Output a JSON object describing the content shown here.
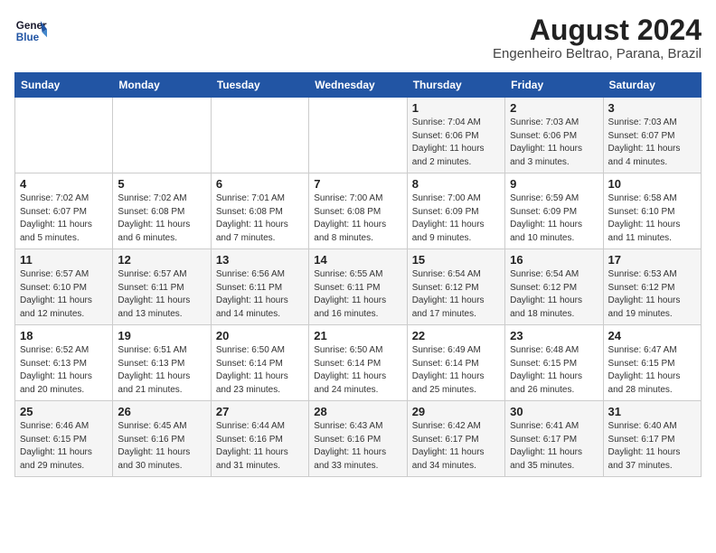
{
  "header": {
    "logo_line1": "General",
    "logo_line2": "Blue",
    "month_year": "August 2024",
    "location": "Engenheiro Beltrao, Parana, Brazil"
  },
  "weekdays": [
    "Sunday",
    "Monday",
    "Tuesday",
    "Wednesday",
    "Thursday",
    "Friday",
    "Saturday"
  ],
  "weeks": [
    [
      {
        "day": "",
        "info": ""
      },
      {
        "day": "",
        "info": ""
      },
      {
        "day": "",
        "info": ""
      },
      {
        "day": "",
        "info": ""
      },
      {
        "day": "1",
        "info": "Sunrise: 7:04 AM\nSunset: 6:06 PM\nDaylight: 11 hours\nand 2 minutes."
      },
      {
        "day": "2",
        "info": "Sunrise: 7:03 AM\nSunset: 6:06 PM\nDaylight: 11 hours\nand 3 minutes."
      },
      {
        "day": "3",
        "info": "Sunrise: 7:03 AM\nSunset: 6:07 PM\nDaylight: 11 hours\nand 4 minutes."
      }
    ],
    [
      {
        "day": "4",
        "info": "Sunrise: 7:02 AM\nSunset: 6:07 PM\nDaylight: 11 hours\nand 5 minutes."
      },
      {
        "day": "5",
        "info": "Sunrise: 7:02 AM\nSunset: 6:08 PM\nDaylight: 11 hours\nand 6 minutes."
      },
      {
        "day": "6",
        "info": "Sunrise: 7:01 AM\nSunset: 6:08 PM\nDaylight: 11 hours\nand 7 minutes."
      },
      {
        "day": "7",
        "info": "Sunrise: 7:00 AM\nSunset: 6:08 PM\nDaylight: 11 hours\nand 8 minutes."
      },
      {
        "day": "8",
        "info": "Sunrise: 7:00 AM\nSunset: 6:09 PM\nDaylight: 11 hours\nand 9 minutes."
      },
      {
        "day": "9",
        "info": "Sunrise: 6:59 AM\nSunset: 6:09 PM\nDaylight: 11 hours\nand 10 minutes."
      },
      {
        "day": "10",
        "info": "Sunrise: 6:58 AM\nSunset: 6:10 PM\nDaylight: 11 hours\nand 11 minutes."
      }
    ],
    [
      {
        "day": "11",
        "info": "Sunrise: 6:57 AM\nSunset: 6:10 PM\nDaylight: 11 hours\nand 12 minutes."
      },
      {
        "day": "12",
        "info": "Sunrise: 6:57 AM\nSunset: 6:11 PM\nDaylight: 11 hours\nand 13 minutes."
      },
      {
        "day": "13",
        "info": "Sunrise: 6:56 AM\nSunset: 6:11 PM\nDaylight: 11 hours\nand 14 minutes."
      },
      {
        "day": "14",
        "info": "Sunrise: 6:55 AM\nSunset: 6:11 PM\nDaylight: 11 hours\nand 16 minutes."
      },
      {
        "day": "15",
        "info": "Sunrise: 6:54 AM\nSunset: 6:12 PM\nDaylight: 11 hours\nand 17 minutes."
      },
      {
        "day": "16",
        "info": "Sunrise: 6:54 AM\nSunset: 6:12 PM\nDaylight: 11 hours\nand 18 minutes."
      },
      {
        "day": "17",
        "info": "Sunrise: 6:53 AM\nSunset: 6:12 PM\nDaylight: 11 hours\nand 19 minutes."
      }
    ],
    [
      {
        "day": "18",
        "info": "Sunrise: 6:52 AM\nSunset: 6:13 PM\nDaylight: 11 hours\nand 20 minutes."
      },
      {
        "day": "19",
        "info": "Sunrise: 6:51 AM\nSunset: 6:13 PM\nDaylight: 11 hours\nand 21 minutes."
      },
      {
        "day": "20",
        "info": "Sunrise: 6:50 AM\nSunset: 6:14 PM\nDaylight: 11 hours\nand 23 minutes."
      },
      {
        "day": "21",
        "info": "Sunrise: 6:50 AM\nSunset: 6:14 PM\nDaylight: 11 hours\nand 24 minutes."
      },
      {
        "day": "22",
        "info": "Sunrise: 6:49 AM\nSunset: 6:14 PM\nDaylight: 11 hours\nand 25 minutes."
      },
      {
        "day": "23",
        "info": "Sunrise: 6:48 AM\nSunset: 6:15 PM\nDaylight: 11 hours\nand 26 minutes."
      },
      {
        "day": "24",
        "info": "Sunrise: 6:47 AM\nSunset: 6:15 PM\nDaylight: 11 hours\nand 28 minutes."
      }
    ],
    [
      {
        "day": "25",
        "info": "Sunrise: 6:46 AM\nSunset: 6:15 PM\nDaylight: 11 hours\nand 29 minutes."
      },
      {
        "day": "26",
        "info": "Sunrise: 6:45 AM\nSunset: 6:16 PM\nDaylight: 11 hours\nand 30 minutes."
      },
      {
        "day": "27",
        "info": "Sunrise: 6:44 AM\nSunset: 6:16 PM\nDaylight: 11 hours\nand 31 minutes."
      },
      {
        "day": "28",
        "info": "Sunrise: 6:43 AM\nSunset: 6:16 PM\nDaylight: 11 hours\nand 33 minutes."
      },
      {
        "day": "29",
        "info": "Sunrise: 6:42 AM\nSunset: 6:17 PM\nDaylight: 11 hours\nand 34 minutes."
      },
      {
        "day": "30",
        "info": "Sunrise: 6:41 AM\nSunset: 6:17 PM\nDaylight: 11 hours\nand 35 minutes."
      },
      {
        "day": "31",
        "info": "Sunrise: 6:40 AM\nSunset: 6:17 PM\nDaylight: 11 hours\nand 37 minutes."
      }
    ]
  ]
}
